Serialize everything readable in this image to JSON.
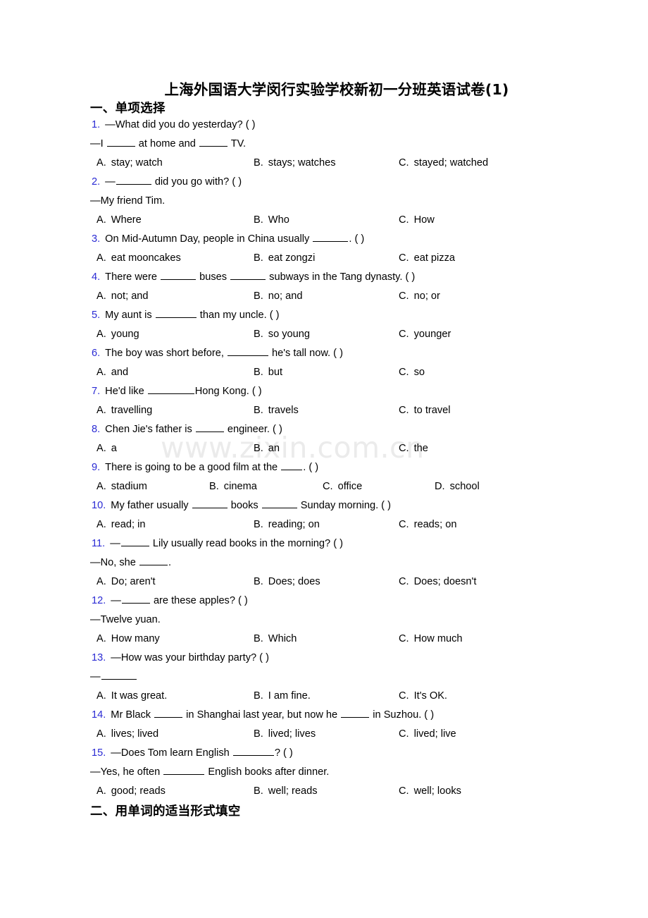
{
  "document": {
    "title": "上海外国语大学闵行实验学校新初一分班英语试卷(1)",
    "watermark": "www.zixin.com.cn"
  },
  "sections": [
    {
      "id": "section-1",
      "heading": "一、单项选择"
    },
    {
      "id": "section-2",
      "heading": "二、用单词的适当形式填空"
    }
  ],
  "questions": [
    {
      "number": "1.",
      "stem": "—What did you do yesterday? (   )",
      "continuation": "—I _____ at home and _____ TV.",
      "options": [
        {
          "label": "A.",
          "text": "stay; watch"
        },
        {
          "label": "B.",
          "text": "stays; watches"
        },
        {
          "label": "C.",
          "text": "stayed; watched"
        }
      ]
    },
    {
      "number": "2.",
      "stem": "—______ did you go with? (   )",
      "continuation": "—My friend Tim.",
      "options": [
        {
          "label": "A.",
          "text": "Where"
        },
        {
          "label": "B.",
          "text": "Who"
        },
        {
          "label": "C.",
          "text": "How"
        }
      ]
    },
    {
      "number": "3.",
      "stem": "On Mid-Autumn Day, people in China usually ______. (   )",
      "continuation": null,
      "options": [
        {
          "label": "A.",
          "text": "eat mooncakes"
        },
        {
          "label": "B.",
          "text": "eat zongzi"
        },
        {
          "label": "C.",
          "text": "eat pizza"
        }
      ]
    },
    {
      "number": "4.",
      "stem": "There were ______ buses ______ subways in the Tang dynasty. (   )",
      "continuation": null,
      "options": [
        {
          "label": "A.",
          "text": "not; and"
        },
        {
          "label": "B.",
          "text": "no; and"
        },
        {
          "label": "C.",
          "text": "no; or"
        }
      ]
    },
    {
      "number": "5.",
      "stem": "My aunt is _______ than my uncle. (   )",
      "continuation": null,
      "options": [
        {
          "label": "A.",
          "text": "young"
        },
        {
          "label": "B.",
          "text": "so young"
        },
        {
          "label": "C.",
          "text": "younger"
        }
      ]
    },
    {
      "number": "6.",
      "stem": "The boy was short before, _______ he's tall now. (   )",
      "continuation": null,
      "options": [
        {
          "label": "A.",
          "text": "and"
        },
        {
          "label": "B.",
          "text": "but"
        },
        {
          "label": "C.",
          "text": "so"
        }
      ]
    },
    {
      "number": "7.",
      "stem": "He'd like _________Hong Kong. (   )",
      "continuation": null,
      "options": [
        {
          "label": "A.",
          "text": "travelling"
        },
        {
          "label": "B.",
          "text": "travels"
        },
        {
          "label": "C.",
          "text": "to travel"
        }
      ]
    },
    {
      "number": "8.",
      "stem": "Chen Jie's father is _____ engineer. (   )",
      "continuation": null,
      "options": [
        {
          "label": "A.",
          "text": "a"
        },
        {
          "label": "B.",
          "text": "an"
        },
        {
          "label": "C.",
          "text": "the"
        }
      ]
    },
    {
      "number": "9.",
      "stem": "There is going to be a good film at the ____. (   )",
      "continuation": null,
      "options": [
        {
          "label": "A.",
          "text": "stadium"
        },
        {
          "label": "B.",
          "text": "cinema"
        },
        {
          "label": "C.",
          "text": "office"
        },
        {
          "label": "D.",
          "text": "school"
        }
      ]
    },
    {
      "number": "10.",
      "stem": "My father usually ______ books ______ Sunday morning. (   )",
      "continuation": null,
      "options": [
        {
          "label": "A.",
          "text": "read; in"
        },
        {
          "label": "B.",
          "text": "reading; on"
        },
        {
          "label": "C.",
          "text": "reads; on"
        }
      ]
    },
    {
      "number": "11.",
      "stem": "—_____ Lily usually read books in the morning? (   )",
      "continuation": "—No, she _____.",
      "options": [
        {
          "label": "A.",
          "text": "Do; aren't"
        },
        {
          "label": "B.",
          "text": "Does; does"
        },
        {
          "label": "C.",
          "text": "Does; doesn't"
        }
      ]
    },
    {
      "number": "12.",
      "stem": "—_____ are these apples? (   )",
      "continuation": "—Twelve yuan.",
      "options": [
        {
          "label": "A.",
          "text": "How many"
        },
        {
          "label": "B.",
          "text": "Which"
        },
        {
          "label": "C.",
          "text": "How much"
        }
      ]
    },
    {
      "number": "13.",
      "stem": "—How was your birthday party? (   )",
      "continuation": "—______",
      "options": [
        {
          "label": "A.",
          "text": "It was great."
        },
        {
          "label": "B.",
          "text": "I am fine."
        },
        {
          "label": "C.",
          "text": "It's OK."
        }
      ]
    },
    {
      "number": "14.",
      "stem": "Mr Black _____ in Shanghai last year, but now he _____ in Suzhou. (   )",
      "continuation": null,
      "options": [
        {
          "label": "A.",
          "text": "lives; lived"
        },
        {
          "label": "B.",
          "text": "lived; lives"
        },
        {
          "label": "C.",
          "text": "lived; live"
        }
      ]
    },
    {
      "number": "15.",
      "stem": "—Does Tom learn English _______? (      )",
      "continuation": "—Yes, he often _______ English books after dinner.",
      "options": [
        {
          "label": "A.",
          "text": "good; reads"
        },
        {
          "label": "B.",
          "text": "well; reads"
        },
        {
          "label": "C.",
          "text": "well; looks"
        }
      ]
    }
  ],
  "colors": {
    "question_number": "#2B2BD4",
    "text": "#000000",
    "watermark": "#ebebeb",
    "page_background": "#ffffff"
  }
}
